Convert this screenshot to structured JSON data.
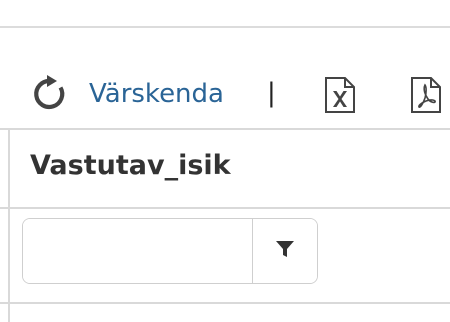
{
  "toolbar": {
    "refresh_label": "Värskenda",
    "separator": "|",
    "icons": [
      "refresh-icon",
      "excel-export-icon",
      "pdf-export-icon"
    ]
  },
  "grid": {
    "column_header": "Vastutav_isik",
    "filter": {
      "value": "",
      "placeholder": "",
      "button_icon": "filter-icon"
    }
  },
  "colors": {
    "link": "#2a6496",
    "header_text": "#333333",
    "border": "#d9d9d9"
  }
}
